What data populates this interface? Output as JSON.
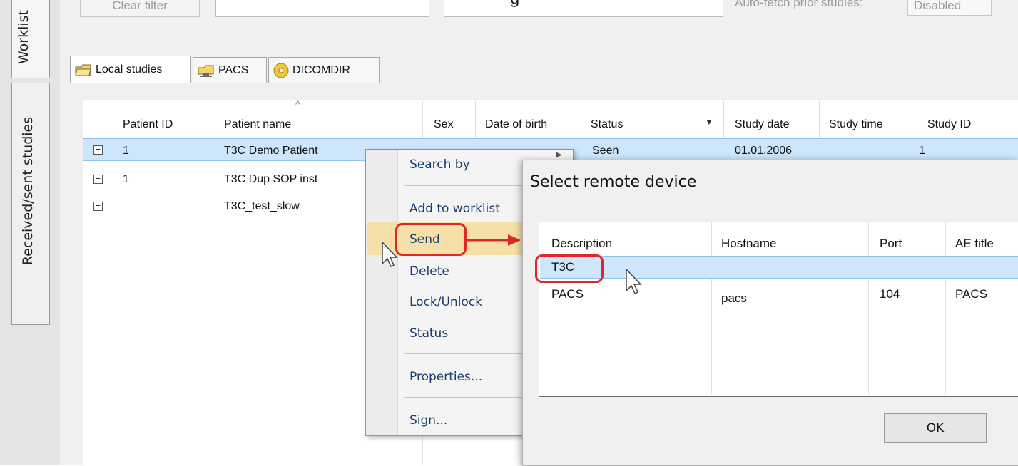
{
  "top_bar": {
    "clear_filter_label": "Clear filter",
    "autofetch_label": "Auto-fetch prior studies:",
    "autofetch_value": "Disabled",
    "top_caption_fragment": "g"
  },
  "left_tabs": [
    {
      "label": "Worklist"
    },
    {
      "label": "Received/sent studies"
    }
  ],
  "source_tabs": [
    {
      "label": "Local studies",
      "icon": "folder-local-icon",
      "active": true
    },
    {
      "label": "PACS",
      "icon": "folder-network-icon",
      "active": false
    },
    {
      "label": "DICOMDIR",
      "icon": "disc-icon",
      "active": false
    }
  ],
  "grid": {
    "columns": [
      "Patient ID",
      "Patient name",
      "Sex",
      "Date of birth",
      "Status",
      "Study date",
      "Study time",
      "Study ID"
    ],
    "sort_column": "Patient name",
    "rows": [
      {
        "patient_id": "1",
        "patient_name": "T3C Demo Patient",
        "status": "Seen",
        "study_date": "01.01.2006",
        "study_id": "1",
        "selected": true
      },
      {
        "patient_id": "1",
        "patient_name": "T3C Dup SOP inst",
        "selected": false
      },
      {
        "patient_id": "",
        "patient_name": "T3C_test_slow",
        "selected": false
      }
    ]
  },
  "context_menu": {
    "items": [
      {
        "label": "Search by"
      },
      {
        "label": "Add to worklist"
      },
      {
        "label": "Send",
        "highlighted": true
      },
      {
        "label": "Delete"
      },
      {
        "label": "Lock/Unlock"
      },
      {
        "label": "Status"
      },
      {
        "label": "Properties..."
      },
      {
        "label": "Sign..."
      }
    ]
  },
  "dialog": {
    "title": "Select remote device",
    "columns": [
      "Description",
      "Hostname",
      "Port",
      "AE title"
    ],
    "rows": [
      {
        "description": "T3C",
        "hostname": "",
        "port": "",
        "ae_title": "",
        "selected": true
      },
      {
        "description": "PACS",
        "hostname": "pacs",
        "port": "104",
        "ae_title": "PACS"
      }
    ],
    "ok_label": "OK"
  },
  "colors": {
    "selection": "#cde6fb",
    "callout": "#e0262b",
    "menu_text": "#1a3d6e",
    "menu_highlight": "#f5e1a8"
  }
}
